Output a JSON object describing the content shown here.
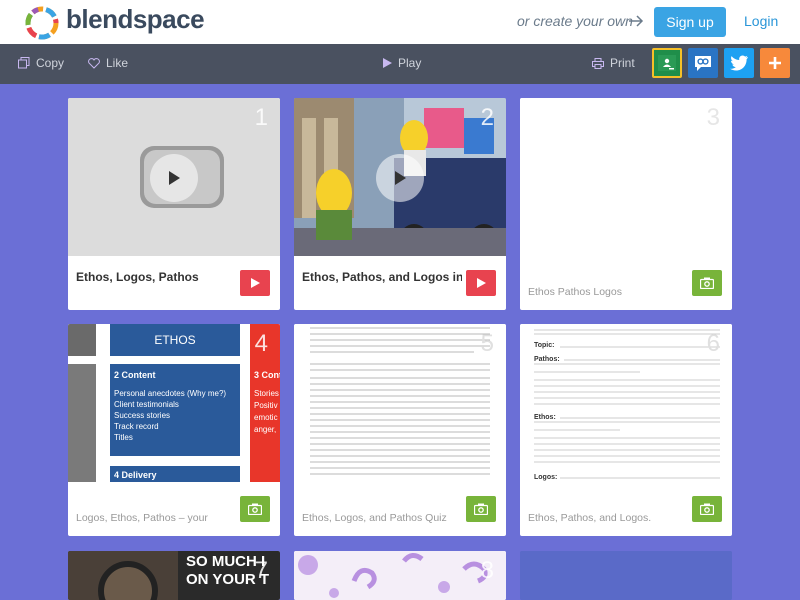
{
  "header": {
    "brand": "blendspace",
    "create_prompt": "or create your own",
    "signup_label": "Sign up",
    "login_label": "Login"
  },
  "toolbar": {
    "copy_label": "Copy",
    "like_label": "Like",
    "play_label": "Play",
    "print_label": "Print",
    "share_buttons": [
      "google-classroom",
      "remind",
      "twitter",
      "add"
    ]
  },
  "colors": {
    "accent_blue": "#3aa4e4",
    "toolbar_bg": "#4a5160",
    "video_button": "#e8434f",
    "image_button": "#78b43a"
  },
  "cards": [
    {
      "number": "1",
      "title": "Ethos, Logos, Pathos",
      "subtitle": "",
      "type": "video"
    },
    {
      "number": "2",
      "title": "Ethos, Pathos, and Logos in...",
      "subtitle": "",
      "type": "video"
    },
    {
      "number": "3",
      "title": "",
      "subtitle": "Ethos Pathos Logos",
      "type": "image"
    },
    {
      "number": "4",
      "title": "",
      "subtitle": "Logos, Ethos, Pathos – your",
      "type": "image",
      "slide": {
        "heading": "ETHOS",
        "box1_title": "2 Content",
        "box1_items": [
          "Personal anecdotes (Why me?)",
          "Client testimonials",
          "Success stories",
          "Track record",
          "Titles"
        ],
        "box2_title": "4 Delivery",
        "box3_title": "3 Cont",
        "box3_items": [
          "Stories",
          "Positiv",
          "emotic",
          "anger,"
        ]
      }
    },
    {
      "number": "5",
      "title": "",
      "subtitle": "Ethos, Logos, and Pathos Quiz",
      "type": "image"
    },
    {
      "number": "6",
      "title": "",
      "subtitle": "Ethos, Pathos, and Logos.",
      "type": "image",
      "doc": {
        "topic": "Topic:",
        "pathos": "Pathos:",
        "ethos": "Ethos:",
        "logos": "Logos:"
      }
    },
    {
      "number": "7",
      "title": "",
      "subtitle": "",
      "type": "image",
      "thumb_text": [
        "SO MUCH I",
        "ON YOUR T"
      ]
    },
    {
      "number": "8",
      "title": "",
      "subtitle": "",
      "type": "image"
    },
    {
      "number": "",
      "title": "",
      "subtitle": "",
      "type": "image"
    }
  ]
}
